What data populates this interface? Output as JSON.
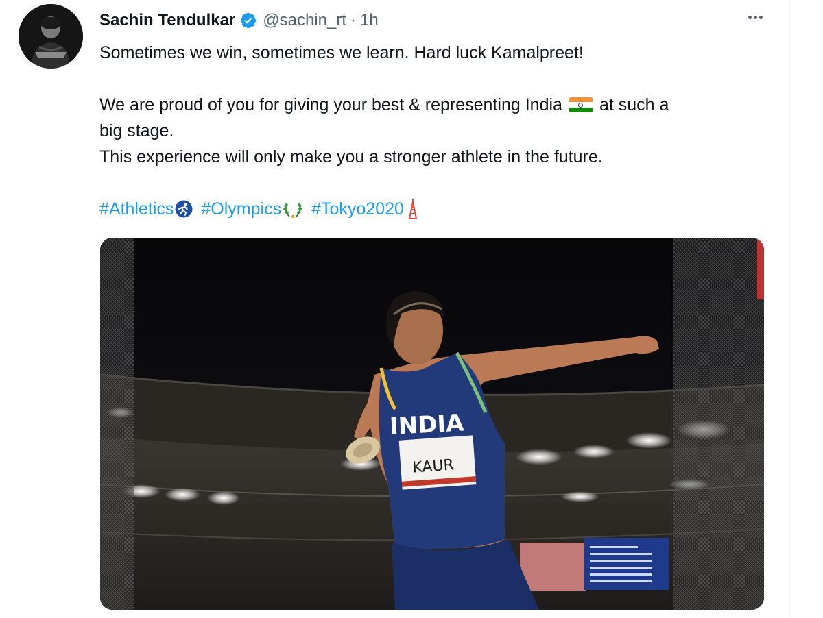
{
  "tweet": {
    "author_name": "Sachin Tendulkar",
    "handle": "@sachin_rt",
    "separator": "·",
    "time": "1h",
    "text": {
      "line1": "Sometimes we win, sometimes we learn. Hard luck Kamalpreet!",
      "line2a": "We are proud of you for giving your best & representing India",
      "line2b": "at such a",
      "line3": "big stage.",
      "line4": "This experience will only make you a stronger athlete in the future."
    },
    "hashtags": [
      "#Athletics",
      "#Olympics",
      "#Tokyo2020"
    ],
    "media": {
      "jersey_country": "INDIA",
      "bib_name": "KAUR"
    }
  },
  "colors": {
    "link": "#1d9bf0",
    "secondary_text": "#536471",
    "verified": "#1d9bf0"
  },
  "icons": [
    "avatar",
    "verified-badge-icon",
    "more-options-icon",
    "india-flag-emoji",
    "running-person-icon",
    "laurel-wreath-icon",
    "tokyo-tower-icon"
  ]
}
